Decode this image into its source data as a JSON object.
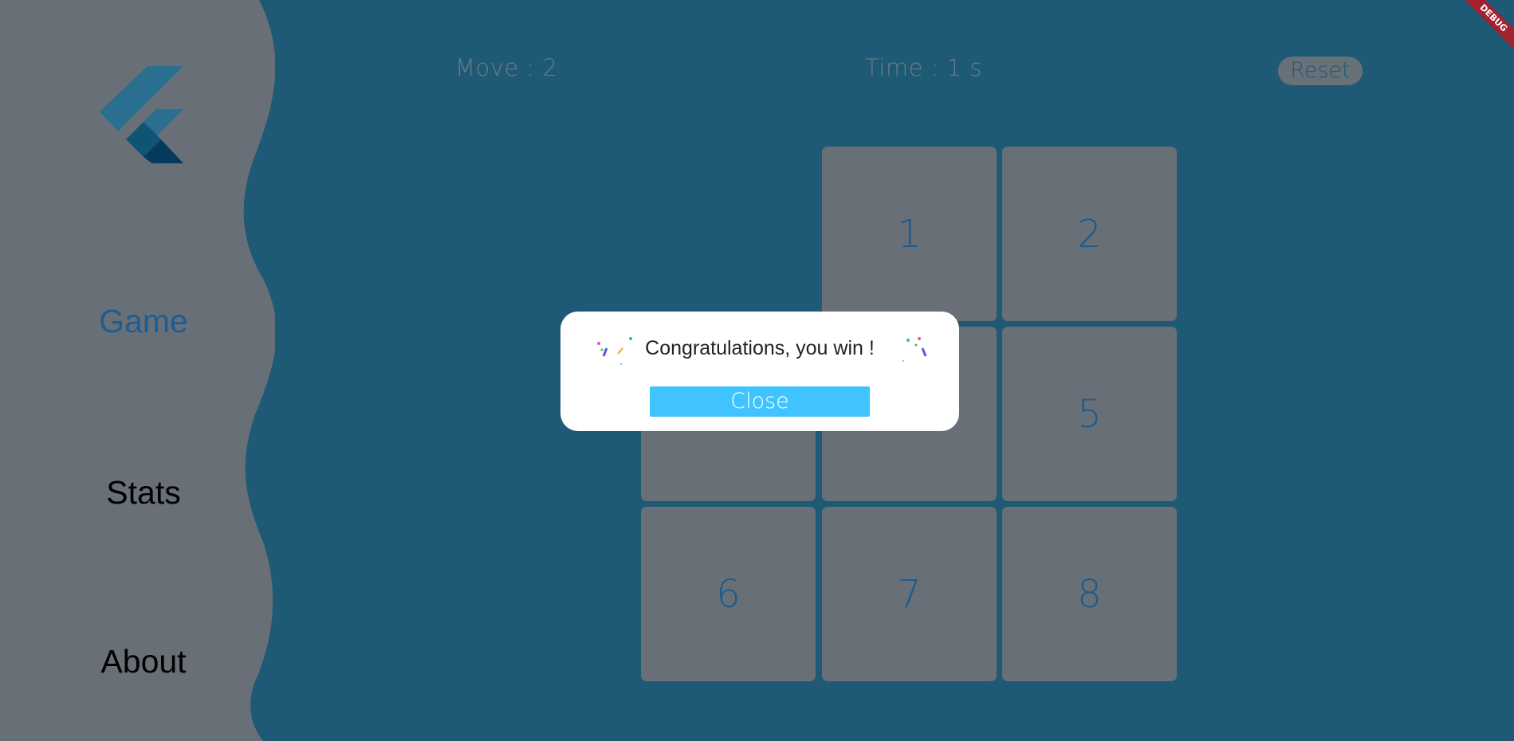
{
  "sidebar": {
    "items": [
      {
        "label": "Game",
        "active": true
      },
      {
        "label": "Stats",
        "active": false
      },
      {
        "label": "About",
        "active": false
      }
    ]
  },
  "header": {
    "moves": "Move : 2",
    "time": "Time : 1 s",
    "reset_label": "Reset"
  },
  "board": {
    "tiles": [
      "1",
      "2",
      "5",
      "6",
      "7",
      "8"
    ]
  },
  "dialog": {
    "message": "Congratulations, you win !",
    "close_label": "Close"
  },
  "debug": "DEBUG",
  "colors": {
    "background": "#1e5a75",
    "sidebar": "#686f77",
    "tile": "#686f77",
    "tile_text": "#1b5b8e",
    "button": "#40c4ff"
  }
}
